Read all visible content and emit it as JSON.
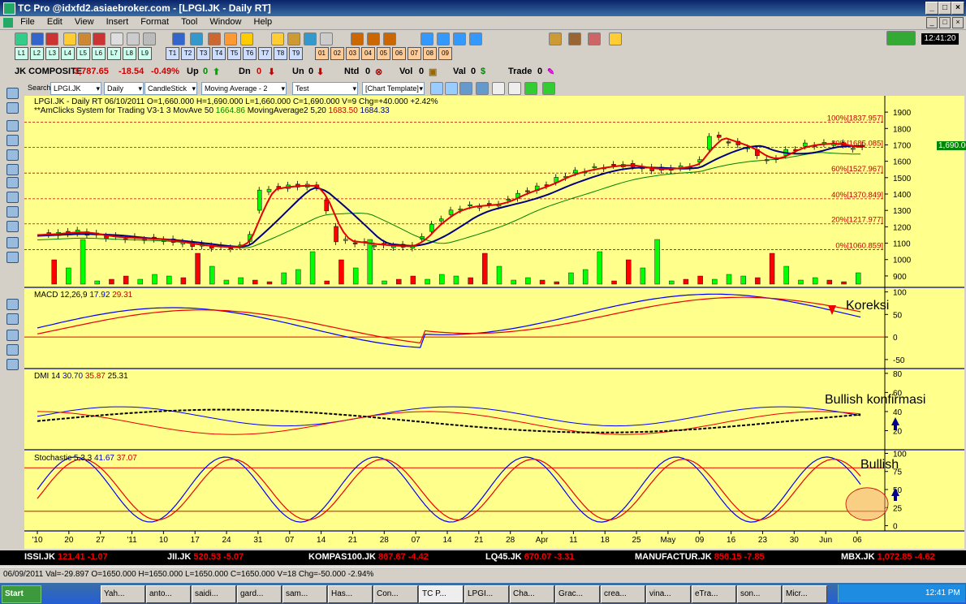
{
  "window": {
    "title": "TC Pro @idxfd2.asiaebroker.com - [LPGI.JK - Daily RT]"
  },
  "menu": [
    "File",
    "Edit",
    "View",
    "Insert",
    "Format",
    "Tool",
    "Window",
    "Help"
  ],
  "clock": "12:41:20",
  "toolbar_layout_tabs": [
    "L1",
    "L2",
    "L3",
    "L4",
    "L5",
    "L6",
    "L7",
    "L8",
    "L9"
  ],
  "toolbar_template_tabs": [
    "T1",
    "T2",
    "T3",
    "T4",
    "T5",
    "T6",
    "T7",
    "T8",
    "T9"
  ],
  "toolbar_misc_tabs": [
    "01",
    "02",
    "03",
    "04",
    "05",
    "06",
    "07",
    "08",
    "09"
  ],
  "stats": {
    "index_name": "JK COMPOSITE",
    "index_value": "3,787.65",
    "index_change": "-18.54",
    "index_pct": "-0.49%",
    "up_label": "Up",
    "up_value": "0",
    "dn_label": "Dn",
    "dn_value": "0",
    "un_label": "Un",
    "un_value": "0",
    "ntd_label": "Ntd",
    "ntd_value": "0",
    "vol_label": "Vol",
    "vol_value": "0",
    "val_label": "Val",
    "val_value": "0",
    "trade_label": "Trade",
    "trade_value": "0"
  },
  "searchbar": {
    "label": "Search",
    "symbol": "LPGI.JK",
    "period": "Daily",
    "chart_type": "CandleStick",
    "indicator": "Moving Average - 2",
    "test": "Test",
    "template": "[Chart Template]"
  },
  "price_panel": {
    "header1": "LPGI.JK - Daily RT  06/10/2011  O=1,660.000  H=1,690.000  L=1,660.000  C=1,690.000  V=9  Chg=+40.000  +2.42%",
    "header2_a": "**AmClicks System for Trading V3-1 3   MovAve 50  ",
    "header2_b": "1664.86",
    "header2_c": "  MovingAverage2 5,20  ",
    "header2_d": "1683.50",
    "header2_e": "  1684.33",
    "last_price": "1,690.00",
    "fib_labels": [
      "100%[1837.957]",
      "80%[1685.085]",
      "60%[1527.967]",
      "40%[1370.849]",
      "20%[1217.977]",
      "0%[1060.859]"
    ],
    "fib_values": [
      1837.957,
      1685.085,
      1527.967,
      1370.849,
      1217.977,
      1060.859
    ],
    "y_ticks": [
      "1900",
      "1800",
      "1700",
      "1600",
      "1500",
      "1400",
      "1300",
      "1200",
      "1100",
      "1000",
      "900"
    ],
    "y_tick_values": [
      1900,
      1800,
      1700,
      1600,
      1500,
      1400,
      1300,
      1200,
      1100,
      1000,
      900
    ]
  },
  "macd_panel": {
    "label": "MACD 12,26,9",
    "v1": "17.92",
    "v2": "29.31",
    "annotation": "Koreksi",
    "y_ticks": [
      "100",
      "50",
      "0",
      "-50"
    ]
  },
  "dmi_panel": {
    "label": "DMI 14",
    "v1": "30.70",
    "v2": "35.87",
    "v3": "25.31",
    "annotation": "Bullish konfirmasi",
    "y_ticks": [
      "80",
      "60",
      "40",
      "20"
    ]
  },
  "stoch_panel": {
    "label": "Stochastic 5,3,3",
    "v1": "41.67",
    "v2": "37.07",
    "annotation": "Bullish",
    "y_ticks": [
      "100",
      "75",
      "50",
      "25",
      "0"
    ]
  },
  "x_axis": [
    "'10",
    "20",
    "27",
    "'11",
    "10",
    "17",
    "24",
    "31",
    "07",
    "14",
    "21",
    "28",
    "07",
    "14",
    "21",
    "28",
    "Apr",
    "11",
    "18",
    "25",
    "May",
    "09",
    "16",
    "23",
    "30",
    "Jun",
    "06"
  ],
  "ticker": [
    {
      "name": "ISSI.JK",
      "value": "121.41",
      "chg": "-1.07"
    },
    {
      "name": "JII.JK",
      "value": "520.53",
      "chg": "-5.07"
    },
    {
      "name": "KOMPAS100.JK",
      "value": "867.67",
      "chg": "-4.42"
    },
    {
      "name": "LQ45.JK",
      "value": "670.07",
      "chg": "-3.31"
    },
    {
      "name": "MANUFACTUR.JK",
      "value": "856.15",
      "chg": "-7.85"
    },
    {
      "name": "MBX.JK",
      "value": "1,072.85",
      "chg": "-4.62"
    }
  ],
  "statusbar": "06/09/2011  Val=-29.897  O=1650.000  H=1650.000  L=1650.000  C=1650.000  V=18  Chg=-50.000  -2.94%",
  "taskbar": {
    "start": "Start",
    "tasks": [
      "Yah...",
      "anto...",
      "saidi...",
      "gard...",
      "sam...",
      "Has...",
      "Con...",
      "TC P...",
      "LPGI...",
      "Cha...",
      "Grac...",
      "crea...",
      "vina...",
      "eTra...",
      "son...",
      "Micr..."
    ],
    "time": "12:41 PM"
  },
  "colors": {
    "chart_bg": "#ffff8c",
    "up": "#00ff00",
    "down": "#ff0000",
    "ma_red": "#e00000",
    "ma_navy": "#000080",
    "ma_green": "#008000",
    "macd_blue": "#0000ff",
    "fib": "#c00000"
  }
}
